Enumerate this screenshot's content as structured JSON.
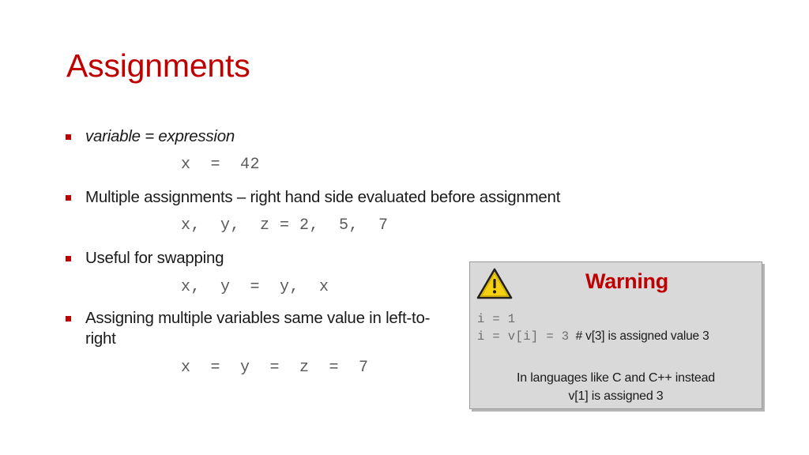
{
  "slide": {
    "title": "Assignments",
    "title_color": "#C00000",
    "background_color": "#ffffff",
    "bullet_color": "#C00000",
    "code_color": "#5a5a5a"
  },
  "body": {
    "blocks": [
      {
        "bullet": "variable = expression",
        "style": "italic",
        "code": "x  =  42"
      },
      {
        "bullet": "Multiple assignments – right hand side evaluated before assignment",
        "style": "normal",
        "code": "x,  y,  z = 2,  5,  7"
      },
      {
        "bullet": "Useful for swapping",
        "style": "normal",
        "code": "x,  y  =  y,  x"
      },
      {
        "bullet": "Assigning multiple variables same value in left-to-right",
        "style": "normal",
        "code": "x  =  y  =  z  =  7"
      }
    ]
  },
  "warning": {
    "icon": "warning-triangle-icon",
    "title": "Warning",
    "title_color": "#C00000",
    "background_color": "#D9D9D9",
    "border_color": "#9a9a9a",
    "code_lines": [
      {
        "code": "i = 1",
        "comment": ""
      },
      {
        "code": "i = v[i] = 3",
        "comment": "# v[3] is assigned value 3"
      }
    ],
    "notes": [
      "In languages like C and C++ instead",
      "v[1] is assigned 3"
    ]
  }
}
